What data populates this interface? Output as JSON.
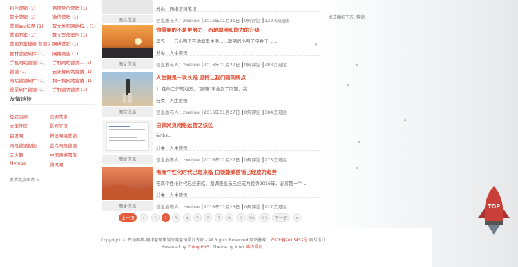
{
  "tag_cloud": [
    [
      "粉丝营销 (1)",
      "百度竞价营销 (1)"
    ],
    [
      "软文营销 (1)",
      "微信营销 (1)"
    ],
    [
      "营销seo标题 (1)",
      "软文发布网站标... (1)"
    ],
    [
      "营销方案 (1)",
      "软文写作案例 (1)"
    ],
    [
      "营销方案模板 营销活... (1)",
      "网络营销 (1)"
    ],
    [
      "食材营销软件 (1)",
      "网络商业 (1)"
    ],
    [
      "手机网站营销 (1)",
      "手机网站营销... (1)"
    ],
    [
      "营销 (1)",
      "云计算网站营销 (1)"
    ],
    [
      "网站营销软件 (1)",
      "揭一揭网站营销 (1)"
    ],
    [
      "投票软件营销 (1)",
      "手机营销营销 (1)"
    ]
  ],
  "links_title": "友情链接",
  "links": [
    [
      "经验资源",
      "资源共享"
    ],
    [
      "大型社区",
      "影视交流"
    ],
    [
      "百度网",
      "新浪网络营销"
    ],
    [
      "网络营销智能",
      "蓝鸟网络营销"
    ],
    [
      "云火箭",
      "中国网络部落"
    ],
    [
      "Mympo",
      "腾讯网"
    ]
  ],
  "apply_link": "友情链接申请 ✎",
  "posts": [
    {
      "title": "",
      "excerpt": "",
      "category": "分类：网络营销笔记",
      "meta": "信息发布人：zwsijue ┃2016年01月31日 ┃0条评论 ┃1220次阅读",
      "caption": "图文信息",
      "thumb": "gray"
    },
    {
      "title": "你需要的不是更努力，而是聪明和能力的升级",
      "excerpt": "早先，一只小鸭子在池塘里生活……聪明的小鸭子学会了……",
      "category": "分类：人生感悟",
      "meta": "信息发布人：zwsijue ┃2016年01月27日 ┃0条评论 ┃283次阅读",
      "caption": "图文信息",
      "thumb": "sunset"
    },
    {
      "title": "人生就是一次长跑 坚持让我们踏到终点",
      "excerpt": "1. 在你工作的地方，“跟随”事业到了问题，我……",
      "category": "分类：人生感悟",
      "meta": "信息发布人：zwsijue ┃2016年01月27日 ┃0条评论 ┃384次阅读",
      "caption": "图文信息",
      "thumb": "runner"
    },
    {
      "title": "白领网页网络运营之误区",
      "excerpt": "&nbs...",
      "category": "分类：人生感悟",
      "meta": "信息发布人：zwsijue ┃2016年01月27日 ┃0条评论 ┃275次阅读",
      "caption": "图文信息",
      "thumb": "doc"
    },
    {
      "title": "电商个性化时代已经来临 白领能够营销已经成为趋势",
      "excerpt": "电商个性化时代已经来临，据调查显示已经成为趋势2016年，必将是一个...",
      "category": "分类：人生感悟",
      "meta": "信息发布人：zwsijue ┃2016年01月26日 ┃0条评论 ┃227次阅读",
      "caption": "图文信息",
      "thumb": "desert"
    }
  ],
  "pager": [
    "上一页",
    "‹",
    "1",
    "2",
    "3",
    "4",
    "5",
    "6",
    "7",
    "8",
    "9",
    "10",
    "11",
    "下一页",
    "»"
  ],
  "pager_current": "2",
  "footer": {
    "copyright": "Copyright © 白领网络-网络营销策划方案营销设计专家 - All Rights Reserved 网站备案：",
    "icp": "沪ICP备2015452号",
    "tail": " 自然设计",
    "powered_prefix": "Powered by ",
    "powered": "Zblog PHP",
    "theme_prefix": " · Theme by Inter ",
    "theme": "简约设计"
  },
  "sidebar_note": "点击图标下方: 营销",
  "top_button": "TOP",
  "colors": {
    "accent": "#e35a3c",
    "link_red": "#d63a2f"
  }
}
